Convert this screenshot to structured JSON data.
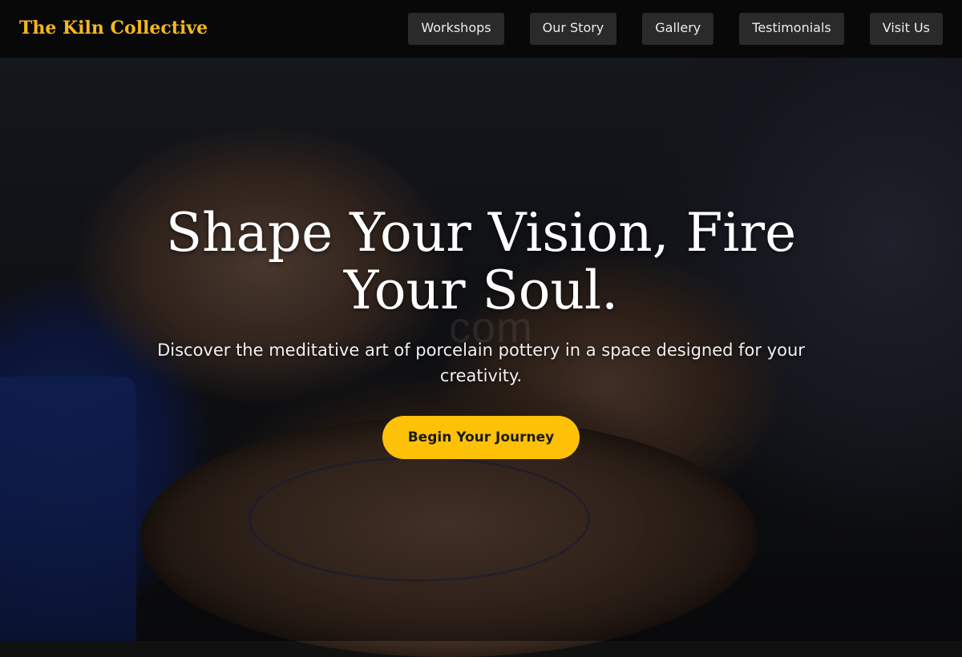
{
  "brand": {
    "name": "The Kiln Collective"
  },
  "nav": {
    "links": [
      {
        "label": "Workshops"
      },
      {
        "label": "Our Story"
      },
      {
        "label": "Gallery"
      },
      {
        "label": "Testimonials"
      },
      {
        "label": "Visit Us"
      }
    ]
  },
  "hero": {
    "title": "Shape Your Vision, Fire Your Soul.",
    "subtitle": "Discover the meditative art of porcelain pottery in a space designed for your creativity.",
    "cta_label": "Begin Your Journey",
    "background_image": "hands-on-pottery-wheel-photo",
    "watermark": "com"
  },
  "colors": {
    "accent": "#ffc107",
    "brand_text": "#f6b81a",
    "nav_background": "#0a0a0a",
    "nav_button": "#2a2a2a"
  }
}
